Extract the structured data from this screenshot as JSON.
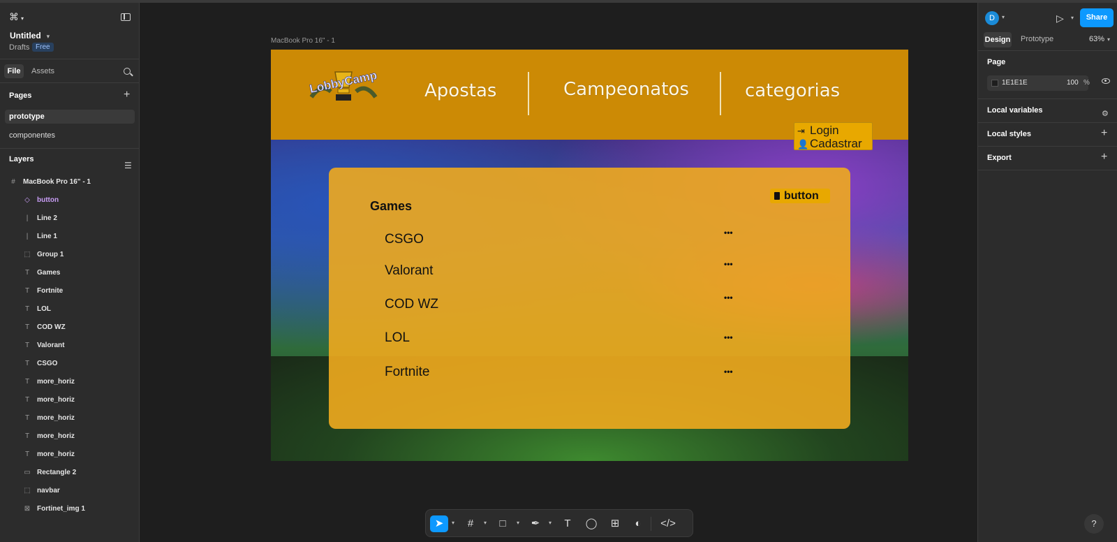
{
  "left_panel": {
    "file_title": "Untitled",
    "drafts": "Drafts",
    "free_badge": "Free",
    "tabs": {
      "file": "File",
      "assets": "Assets"
    },
    "pages_title": "Pages",
    "pages": [
      "prototype",
      "componentes"
    ],
    "layers_title": "Layers",
    "layers": [
      {
        "name": "MacBook Pro 16\" - 1",
        "icon": "#"
      },
      {
        "name": "button",
        "icon": "◇"
      },
      {
        "name": "Line 2",
        "icon": "|"
      },
      {
        "name": "Line 1",
        "icon": "|"
      },
      {
        "name": "Group 1",
        "icon": "⬚"
      },
      {
        "name": "Games",
        "icon": "T"
      },
      {
        "name": "Fortnite",
        "icon": "T"
      },
      {
        "name": "LOL",
        "icon": "T"
      },
      {
        "name": "COD WZ",
        "icon": "T"
      },
      {
        "name": "Valorant",
        "icon": "T"
      },
      {
        "name": "CSGO",
        "icon": "T"
      },
      {
        "name": "more_horiz",
        "icon": "T"
      },
      {
        "name": "more_horiz",
        "icon": "T"
      },
      {
        "name": "more_horiz",
        "icon": "T"
      },
      {
        "name": "more_horiz",
        "icon": "T"
      },
      {
        "name": "more_horiz",
        "icon": "T"
      },
      {
        "name": "Rectangle 2",
        "icon": "▭"
      },
      {
        "name": "navbar",
        "icon": "⬚"
      },
      {
        "name": "Fortinet_img 1",
        "icon": "⊠"
      }
    ]
  },
  "canvas": {
    "frame_label": "MacBook Pro 16\" - 1",
    "logo_text": "LobbyCamp",
    "nav": [
      "Apostas",
      "Campeonatos",
      "categorias"
    ],
    "auth": {
      "login": "Login",
      "register": "Cadastrar"
    },
    "card": {
      "title": "Games",
      "button_label": "button",
      "games": [
        "CSGO",
        "Valorant",
        "COD WZ",
        "LOL",
        "Fortnite"
      ],
      "more_glyph": "•••"
    }
  },
  "toolbar": {
    "tools": [
      "move",
      "frame",
      "rectangle",
      "pen",
      "text",
      "comment",
      "actions",
      "ai",
      "dev-mode"
    ]
  },
  "right_panel": {
    "avatar_letter": "D",
    "share": "Share",
    "tabs": {
      "design": "Design",
      "prototype": "Prototype"
    },
    "zoom": "63%",
    "page_section": "Page",
    "page_color": "1E1E1E",
    "page_opacity": "100",
    "pct": "%",
    "local_variables": "Local variables",
    "local_styles": "Local styles",
    "export": "Export",
    "help": "?"
  },
  "colors": {
    "accent": "#0d99ff",
    "navbar": "#cc8a05",
    "card": "#f0aa1e",
    "component_purple": "#c89df5"
  }
}
